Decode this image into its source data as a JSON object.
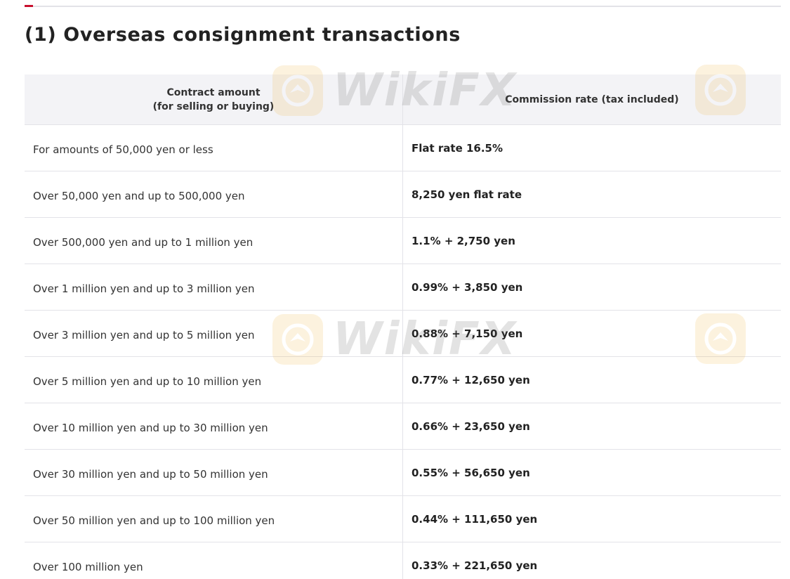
{
  "section": {
    "title": "(1) Overseas consignment transactions"
  },
  "table": {
    "headers": {
      "amount_line1": "Contract amount",
      "amount_line2": "(for selling or buying)",
      "rate": "Commission rate (tax included)"
    },
    "rows": [
      {
        "amount": "For amounts of 50,000 yen or less",
        "rate": "Flat rate 16.5%"
      },
      {
        "amount": "Over 50,000 yen and up to 500,000 yen",
        "rate": "8,250 yen flat rate"
      },
      {
        "amount": "Over 500,000 yen and up to 1 million yen",
        "rate": "1.1% + 2,750 yen"
      },
      {
        "amount": "Over 1 million yen and up to 3 million yen",
        "rate": "0.99% + 3,850 yen"
      },
      {
        "amount": "Over 3 million yen and up to 5 million yen",
        "rate": "0.88% + 7,150 yen"
      },
      {
        "amount": "Over 5 million yen and up to 10 million yen",
        "rate": "0.77% + 12,650 yen"
      },
      {
        "amount": "Over 10 million yen and up to 30 million yen",
        "rate": "0.66% + 23,650 yen"
      },
      {
        "amount": "Over 30 million yen and up to 50 million yen",
        "rate": "0.55% + 56,650 yen"
      },
      {
        "amount": "Over 50 million yen and up to 100 million yen",
        "rate": "0.44% + 111,650 yen"
      },
      {
        "amount": "Over 100 million yen",
        "rate": "0.33% + 221,650 yen"
      }
    ]
  },
  "watermark": {
    "text": "WikiFX",
    "badge_color": "#f2b23a",
    "icon": "wikifx-logo-icon"
  },
  "colors": {
    "accent": "#c8102e",
    "header_bg": "#f3f3f6",
    "border": "#e3e3e8"
  }
}
